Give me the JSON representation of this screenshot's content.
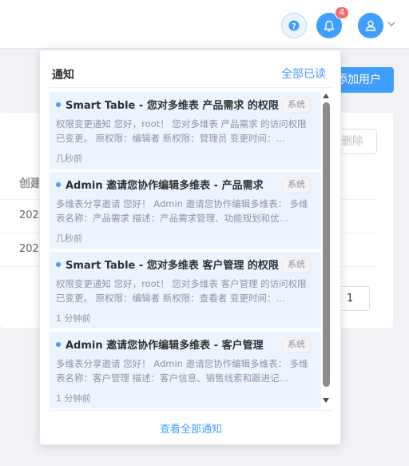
{
  "header": {
    "help_icon": "question-circle-icon",
    "bell_icon": "bell-icon",
    "unread_count": "4",
    "user_icon": "user-icon",
    "chevron_icon": "chevron-down-icon"
  },
  "page": {
    "add_user_label": "添加用户",
    "delete_label": "删除",
    "column_created": "创建",
    "row1_created": "2020",
    "row2_created": "2020",
    "page_number": "1"
  },
  "notifications": {
    "title": "通知",
    "mark_all_read": "全部已读",
    "view_all": "查看全部通知",
    "items": [
      {
        "title": "Smart Table - 您对多维表 产品需求 的权限...",
        "tag": "系统",
        "body": "权限变更通知 您好，root！ 您对多维表 产品需求 的访问权限已变更。 原权限：编辑者 新权限：管理员 变更时间：...",
        "time": "几秒前"
      },
      {
        "title": "Admin 邀请您协作编辑多维表 - 产品需求",
        "tag": "系统",
        "body": "多维表分享邀请 您好！ Admin 邀请您协作编辑多维表： 多维表名称：产品需求 描述：产品需求管理、功能规划和优...",
        "time": "几秒前"
      },
      {
        "title": "Smart Table - 您对多维表 客户管理 的权限...",
        "tag": "系统",
        "body": "权限变更通知 您好，root！ 您对多维表 客户管理 的访问权限已变更。 原权限：编辑者 新权限：查看者 变更时间：...",
        "time": "1 分钟前"
      },
      {
        "title": "Admin 邀请您协作编辑多维表 - 客户管理",
        "tag": "系统",
        "body": "多维表分享邀请 您好！ Admin 邀请您协作编辑多维表： 多维表名称：客户管理 描述：客户信息、销售线索和跟进记...",
        "time": "1 分钟前"
      }
    ]
  },
  "colors": {
    "primary": "#409eff",
    "badge": "#f56c6c",
    "item_bg": "#ecf5ff"
  }
}
